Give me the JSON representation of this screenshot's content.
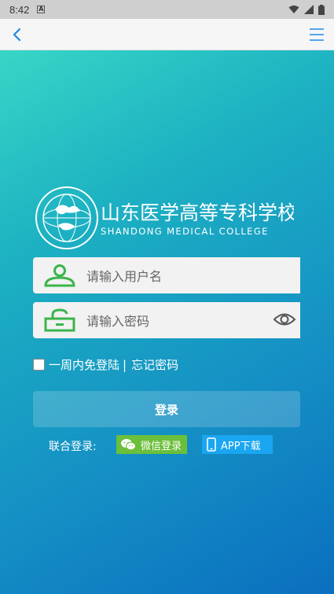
{
  "status_bar": {
    "time": "8:42",
    "notification_icon": "a-icon",
    "icons": [
      "wifi-icon",
      "signal-icon",
      "battery-icon"
    ]
  },
  "nav": {
    "back_icon": "chevron-left-icon",
    "menu_icon": "menu-icon",
    "accent_color": "#1e88e5"
  },
  "logo": {
    "name_cn": "山东医学高等专科学校",
    "name_en": "SHANDONG MEDICAL COLLEGE"
  },
  "form": {
    "username_placeholder": "请输入用户名",
    "password_placeholder": "请输入密码",
    "remember_label": "一周内免登陆",
    "separator": "|",
    "forgot_label": "忘记密码",
    "login_label": "登录"
  },
  "social": {
    "joint_label": "联合登录:",
    "wechat_label": "微信登录",
    "app_label": "APP下载",
    "wechat_color": "#6bbf3b",
    "app_color": "#1aa6f0"
  }
}
